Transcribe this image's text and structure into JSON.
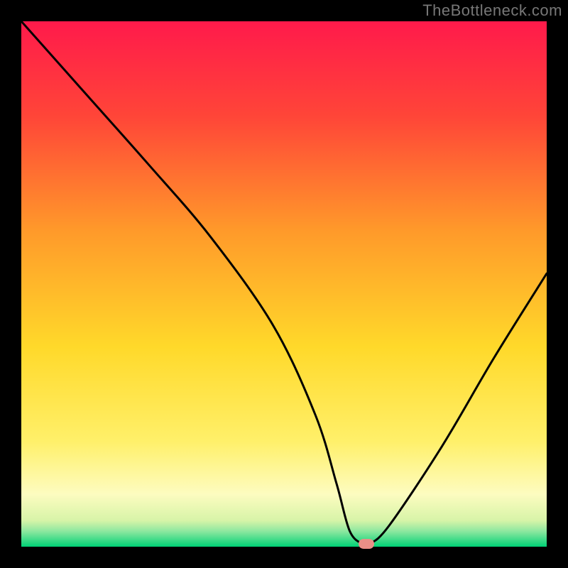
{
  "watermark": "TheBottleneck.com",
  "colors": {
    "gradient_top": "#ff1a4b",
    "gradient_mid1": "#ff8a2a",
    "gradient_mid2": "#ffe22a",
    "gradient_low": "#fff9b0",
    "gradient_bottom": "#00d276",
    "curve": "#000000",
    "marker": "#e98f87",
    "frame": "#000000"
  },
  "chart_data": {
    "type": "line",
    "title": "",
    "xlabel": "",
    "ylabel": "",
    "xlim": [
      0,
      100
    ],
    "ylim": [
      0,
      100
    ],
    "grid": false,
    "x": [
      0,
      12,
      24,
      36,
      48,
      56,
      60,
      62.5,
      65,
      66.25,
      70,
      80,
      90,
      100
    ],
    "values": [
      100,
      86.5,
      73,
      59,
      42,
      25,
      12,
      3,
      0.5,
      0.5,
      4,
      19,
      36,
      52
    ],
    "marker": {
      "x": 65.7,
      "y": 0.5
    },
    "annotations": [],
    "legend": []
  }
}
